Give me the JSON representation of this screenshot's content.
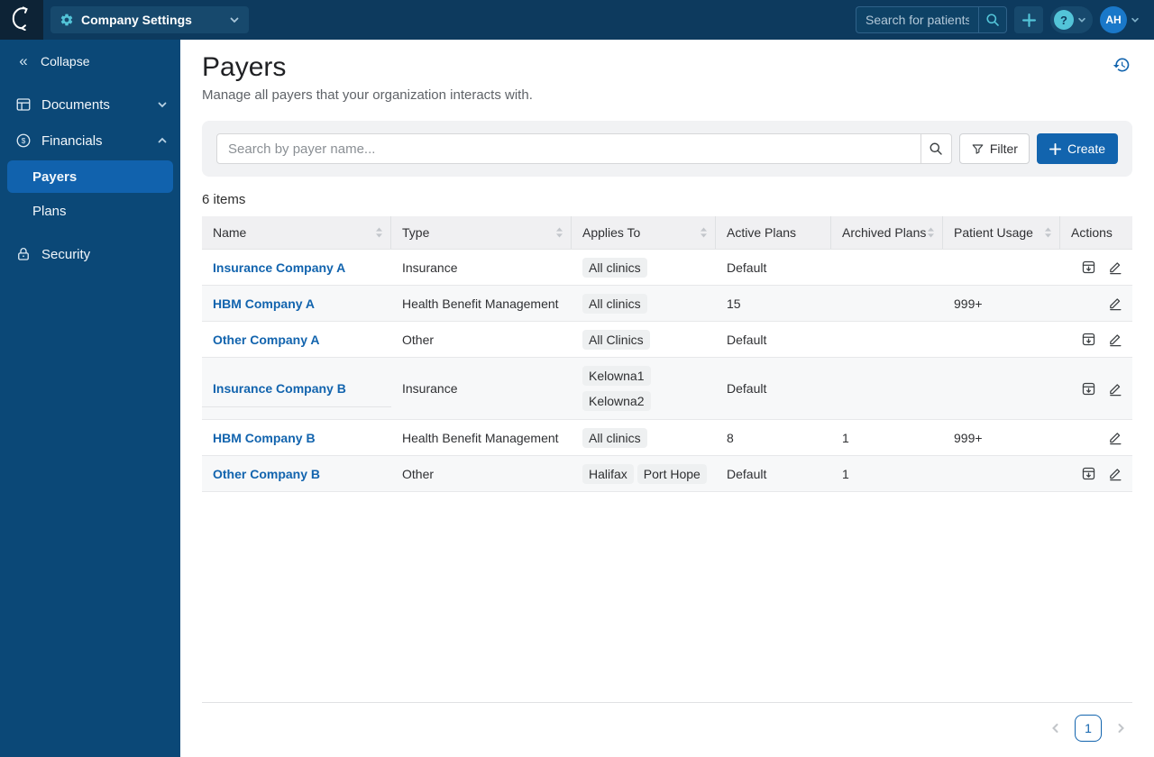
{
  "colors": {
    "topbar_bg": "#0d3a5e",
    "sidebar_bg": "#0b4877",
    "accent_teal": "#53c4d8",
    "brand_blue": "#1264ae",
    "avatar_blue": "#1a78c9"
  },
  "icons": {
    "logo": "jane-swoosh",
    "workspace": "gear",
    "topbar_search": "magnifier",
    "topbar_add": "plus",
    "help": "question-circle",
    "collapse": "double-chevron-left",
    "documents": "layout-window",
    "financials": "dollar-circle",
    "security": "lock",
    "history": "clock-history",
    "filter": "funnel",
    "create": "plus",
    "sort": "sort-carets",
    "archive": "archive-box",
    "edit": "pencil"
  },
  "topbar": {
    "workspace_label": "Company Settings",
    "search_placeholder": "Search for patients...",
    "help_glyph": "?",
    "avatar_initials": "AH"
  },
  "sidebar": {
    "collapse_label": "Collapse",
    "collapse_glyph": "«",
    "items": [
      {
        "label": "Documents"
      },
      {
        "label": "Financials"
      },
      {
        "label": "Payers"
      },
      {
        "label": "Plans"
      },
      {
        "label": "Security"
      }
    ]
  },
  "page": {
    "title": "Payers",
    "subtitle": "Manage all payers that your organization interacts with.",
    "items_count": "6 items"
  },
  "toolbar": {
    "search_placeholder": "Search by payer name...",
    "filter_label": "Filter",
    "create_label": "Create"
  },
  "table": {
    "columns": [
      {
        "label": "Name",
        "sortable": true
      },
      {
        "label": "Type",
        "sortable": true
      },
      {
        "label": "Applies To",
        "sortable": true
      },
      {
        "label": "Active Plans",
        "sortable": false
      },
      {
        "label": "Archived Plans",
        "sortable": true
      },
      {
        "label": "Patient Usage",
        "sortable": true
      },
      {
        "label": "Actions",
        "sortable": false
      }
    ],
    "rows": [
      {
        "name": "Insurance Company A",
        "type": "Insurance",
        "applies_to": [
          "All clinics"
        ],
        "stacked": false,
        "active_plans": "Default",
        "archived_plans": "",
        "patient_usage": "",
        "actions": [
          "archive",
          "edit"
        ],
        "name_divider": false
      },
      {
        "name": "HBM Company A",
        "type": "Health Benefit Management",
        "applies_to": [
          "All clinics"
        ],
        "stacked": false,
        "active_plans": "15",
        "archived_plans": "",
        "patient_usage": "999+",
        "actions": [
          "edit"
        ],
        "name_divider": false
      },
      {
        "name": "Other Company A",
        "type": "Other",
        "applies_to": [
          "All Clinics"
        ],
        "stacked": false,
        "active_plans": "Default",
        "archived_plans": "",
        "patient_usage": "",
        "actions": [
          "archive",
          "edit"
        ],
        "name_divider": false
      },
      {
        "name": "Insurance Company B",
        "type": "Insurance",
        "applies_to": [
          "Kelowna1",
          "Kelowna2"
        ],
        "stacked": true,
        "active_plans": "Default",
        "archived_plans": "",
        "patient_usage": "",
        "actions": [
          "archive",
          "edit"
        ],
        "name_divider": true
      },
      {
        "name": "HBM Company B",
        "type": "Health Benefit Management",
        "applies_to": [
          "All clinics"
        ],
        "stacked": false,
        "active_plans": "8",
        "archived_plans": "1",
        "patient_usage": "999+",
        "actions": [
          "edit"
        ],
        "name_divider": false
      },
      {
        "name": "Other Company B",
        "type": "Other",
        "applies_to": [
          "Halifax",
          "Port Hope"
        ],
        "stacked": false,
        "active_plans": "Default",
        "archived_plans": "1",
        "patient_usage": "",
        "actions": [
          "archive",
          "edit"
        ],
        "name_divider": false
      }
    ]
  },
  "pagination": {
    "current_page": "1"
  }
}
